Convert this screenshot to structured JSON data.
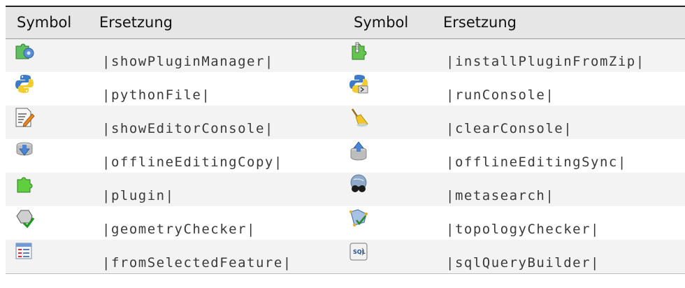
{
  "header": {
    "symbol1": "Symbol",
    "ersetzung1": "Ersetzung",
    "symbol2": "Symbol",
    "ersetzung2": "Ersetzung"
  },
  "rows": [
    {
      "left": {
        "icon": "plugin-manager-icon",
        "code": "|showPluginManager|"
      },
      "right": {
        "icon": "install-plugin-zip-icon",
        "code": "|installPluginFromZip|"
      }
    },
    {
      "left": {
        "icon": "python-file-icon",
        "code": "|pythonFile|"
      },
      "right": {
        "icon": "python-console-icon",
        "code": "|runConsole|"
      }
    },
    {
      "left": {
        "icon": "editor-console-icon",
        "code": "|showEditorConsole|"
      },
      "right": {
        "icon": "clear-console-broom-icon",
        "code": "|clearConsole|"
      }
    },
    {
      "left": {
        "icon": "offline-editing-copy-icon",
        "code": "|offlineEditingCopy|"
      },
      "right": {
        "icon": "offline-editing-sync-icon",
        "code": "|offlineEditingSync|"
      }
    },
    {
      "left": {
        "icon": "plugin-icon",
        "code": "|plugin|"
      },
      "right": {
        "icon": "metasearch-icon",
        "code": "|metasearch|"
      }
    },
    {
      "left": {
        "icon": "geometry-checker-icon",
        "code": "|geometryChecker|"
      },
      "right": {
        "icon": "topology-checker-icon",
        "code": "|topologyChecker|"
      }
    },
    {
      "left": {
        "icon": "from-selected-feature-icon",
        "code": "|fromSelectedFeature|"
      },
      "right": {
        "icon": "sql-query-builder-icon",
        "code": "|sqlQueryBuilder|"
      }
    }
  ]
}
